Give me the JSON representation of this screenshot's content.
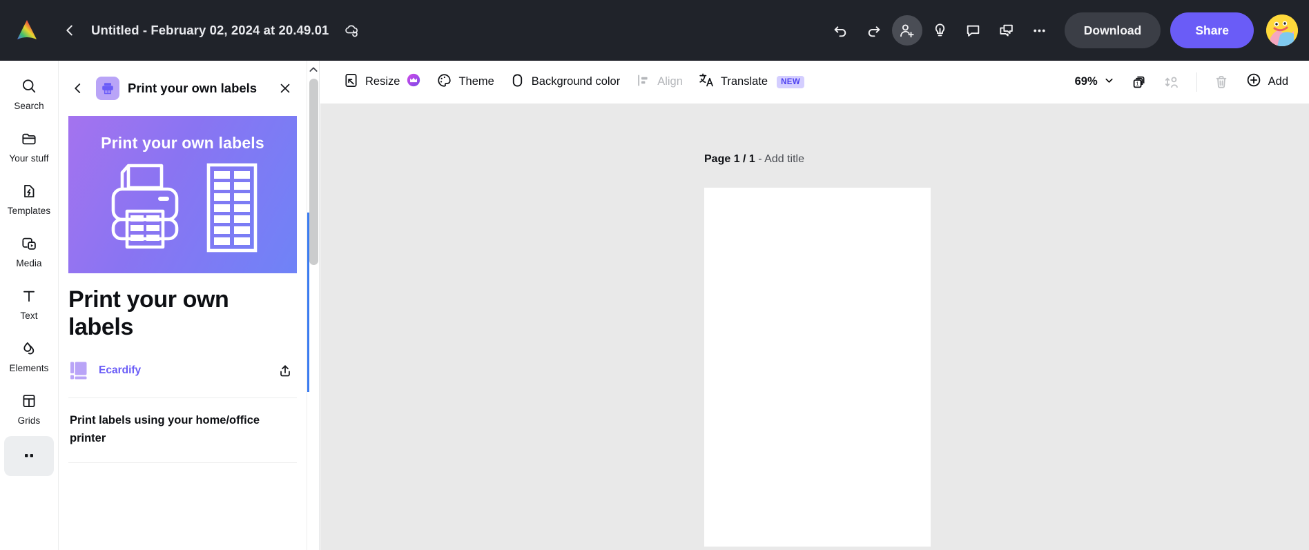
{
  "topbar": {
    "logo_icon": "canva-logo-icon",
    "back_icon": "chevron-left-icon",
    "doc_title": "Untitled - February 02, 2024 at 20.49.01",
    "cloud_icon": "cloud-sync-icon",
    "undo_icon": "undo-icon",
    "redo_icon": "redo-icon",
    "invite_icon": "person-add-icon",
    "ideas_icon": "lightbulb-icon",
    "comment_icon": "comment-icon",
    "duplicate_icon": "duplicate-chat-icon",
    "more_icon": "ellipsis-icon",
    "download_label": "Download",
    "share_label": "Share",
    "avatar_label": "avatar",
    "share_color": "#6a5cf7",
    "bar_color": "#20232a"
  },
  "rail": {
    "items": [
      {
        "label": "Search",
        "icon": "search-icon"
      },
      {
        "label": "Your stuff",
        "icon": "folder-icon"
      },
      {
        "label": "Templates",
        "icon": "templates-icon"
      },
      {
        "label": "Media",
        "icon": "media-icon"
      },
      {
        "label": "Text",
        "icon": "text-icon"
      },
      {
        "label": "Elements",
        "icon": "elements-icon"
      },
      {
        "label": "Grids",
        "icon": "grids-icon"
      }
    ],
    "more_icon": "more-dots-icon"
  },
  "panel": {
    "back_icon": "chevron-left-icon",
    "thumb_icon": "printer-thumbnail-icon",
    "header_title": "Print your own labels",
    "close_icon": "close-icon",
    "hero_title": "Print your own labels",
    "hero_gradient_from": "#a473ef",
    "hero_gradient_to": "#6f83f7",
    "hero_art_icons": [
      "printer-icon",
      "label-sheet-icon"
    ],
    "title": "Print your own labels",
    "author_logo_icon": "ecardify-logo-icon",
    "author": "Ecardify",
    "author_color": "#6a5cf7",
    "share_icon": "share-up-icon",
    "description": "Print labels using your home/office printer"
  },
  "scrollbar": {
    "up_icon": "chevron-up-icon",
    "thumb_color": "#cbcccd",
    "accent_color": "#3b7cf0"
  },
  "toolbar": {
    "resize_label": "Resize",
    "resize_icon": "resize-icon",
    "resize_crown_icon": "crown-icon",
    "theme_label": "Theme",
    "theme_icon": "palette-icon",
    "background_label": "Background color",
    "background_icon": "background-swatch-icon",
    "align_label": "Align",
    "align_icon": "align-icon",
    "translate_label": "Translate",
    "translate_icon": "translate-icon",
    "translate_badge": "NEW",
    "zoom_value": "69%",
    "zoom_chevron_icon": "chevron-down-icon",
    "pages_icon": "page-count-icon",
    "animate_icon": "animate-icon",
    "delete_icon": "trash-icon",
    "add_icon": "plus-circle-icon",
    "add_label": "Add"
  },
  "canvas": {
    "page_prefix": "Page 1 / 1",
    "page_separator": " - ",
    "page_title_placeholder": "Add title",
    "background_color": "#e9e9e9",
    "sheet_color": "#ffffff"
  }
}
